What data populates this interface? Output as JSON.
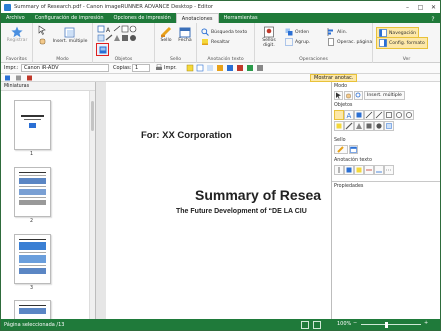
{
  "window": {
    "title": "Summary of Research.pdf - Canon imageRUNNER ADVANCE Desktop - Editor"
  },
  "menu_tabs": [
    "Archivo",
    "Configuración de impresión",
    "Opciones de impresión",
    "Anotaciones",
    "Herramientas"
  ],
  "active_tab": "Anotaciones",
  "ribbon": {
    "registrar": "Registrar",
    "insert_multiple": "Insert. múltiple",
    "sello": "Sello",
    "fecha": "Fecha",
    "busqueda_texto": "Búsqueda texto",
    "resaltar": "Resaltar",
    "sellos_digit": "Sellos digit.",
    "orden": "Orden",
    "agrup": "Agrup.",
    "alin": "Alin.",
    "operac_pagina": "Operac. página",
    "navegacion": "Navegación",
    "config_formato": "Config. formato",
    "groups": {
      "favoritos": "Favoritos",
      "modo": "Modo",
      "objetos": "Objetos",
      "sello": "Sello",
      "anotacion_texto": "Anotación texto",
      "operaciones": "Operaciones",
      "ver": "Ver"
    }
  },
  "toolbar": {
    "printer_label": "Impr.:",
    "printer_value": "Canon iR-ADV",
    "copies_label": "Copias:",
    "copies_value": "1",
    "print_button": "Impr.",
    "show_annotations": "Mostrar anotac."
  },
  "left_pane": {
    "title": "Miniaturas",
    "pages": [
      "1",
      "2",
      "3"
    ]
  },
  "document": {
    "for_line": "For: XX Corporation",
    "title": "Summary of Resea",
    "subtitle": "The Future Development of “DE LA CIU"
  },
  "right_pane": {
    "sections": [
      "Modo",
      "Objetos",
      "Sello",
      "Anotación texto",
      "Propiedades"
    ],
    "insert_multiple": "Insert. múltiple"
  },
  "status": {
    "left": "Página seleccionada /13",
    "zoom": "100%"
  },
  "colors": {
    "accent_green": "#1f7a3a",
    "highlight": "#fde8a8",
    "selection_red": "#e02020"
  }
}
